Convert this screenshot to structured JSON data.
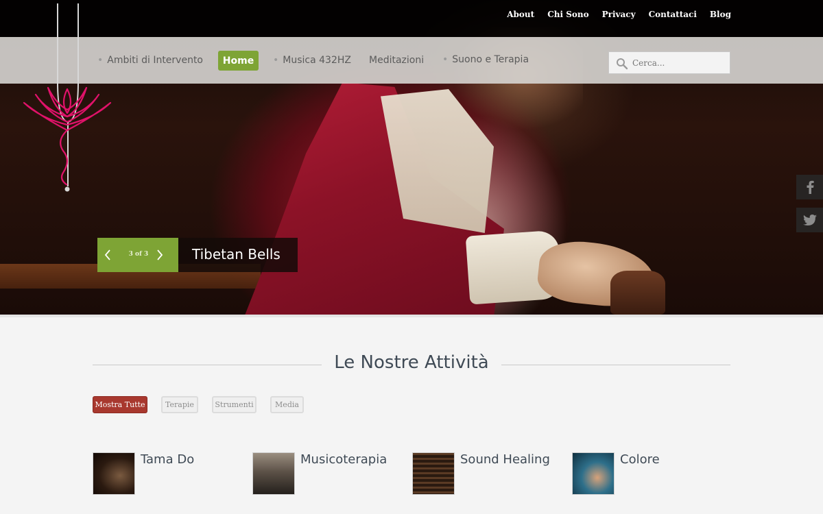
{
  "top_nav": {
    "items": [
      "About",
      "Chi Sono",
      "Privacy",
      "Contattaci",
      "Blog"
    ]
  },
  "main_nav": {
    "items": [
      {
        "label": "Ambiti di Intervento",
        "active": false
      },
      {
        "label": "Home",
        "active": true
      },
      {
        "label": "Musica 432HZ",
        "active": false
      },
      {
        "label": "Meditazioni",
        "active": false
      },
      {
        "label": "Suono e Terapia",
        "active": false
      }
    ],
    "accent_color": "#7ea435"
  },
  "search": {
    "placeholder": "Cerca...",
    "value": "",
    "icon": "search-icon"
  },
  "slider": {
    "counter": "3 of 3",
    "title": "Tibetan Bells",
    "prev_icon": "chevron-left-icon",
    "next_icon": "chevron-right-icon"
  },
  "social": {
    "items": [
      "facebook-icon",
      "twitter-icon"
    ]
  },
  "activities": {
    "title": "Le Nostre Attività",
    "filters": [
      {
        "label": "Mostra Tutte",
        "active": true
      },
      {
        "label": "Terapie",
        "active": false
      },
      {
        "label": "Strumenti",
        "active": false
      },
      {
        "label": "Media",
        "active": false
      }
    ],
    "filter_active_color": "#a8382e",
    "items": [
      {
        "title": "Tama Do"
      },
      {
        "title": "Musicoterapia"
      },
      {
        "title": "Sound Healing"
      },
      {
        "title": "Colore"
      }
    ]
  }
}
